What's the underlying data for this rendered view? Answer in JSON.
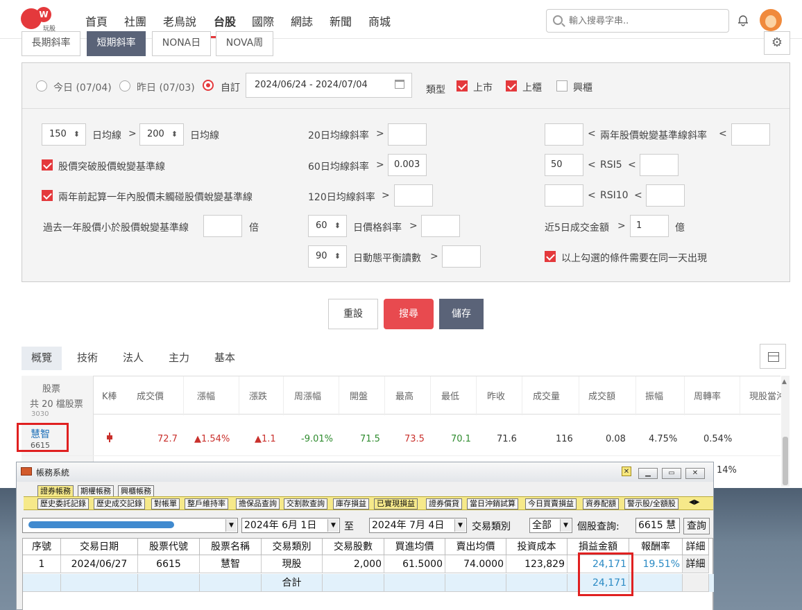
{
  "nav": {
    "logo_text": "玩股網",
    "logo_mark": "W",
    "items": [
      "首頁",
      "社團",
      "老鳥說",
      "台股",
      "國際",
      "網誌",
      "新聞",
      "商城"
    ],
    "active": "台股",
    "search_placeholder": "輸入搜尋字串.."
  },
  "subtabs": [
    "長期斜率",
    "短期斜率",
    "NONA日",
    "NOVA周"
  ],
  "filter": {
    "radio_today": "今日 (07/04)",
    "radio_yesterday": "昨日 (07/03)",
    "radio_custom": "自訂",
    "date_range": "2024/06/24 - 2024/07/04",
    "type_label": "類型",
    "type_listed": "上市",
    "type_otc": "上櫃",
    "type_emerging": "興櫃",
    "ma_a": "150",
    "ma_label_1": "日均線",
    "gt": ">",
    "lt": "<",
    "ma_b": "200",
    "ma_label_2": "日均線",
    "check_break": "股價突破股價蛻變基準線",
    "check_two_year": "兩年前起算一年內股價未觸碰股價蛻變基準線",
    "past_year_label": "過去一年股價小於股價蛻變基準線",
    "times": "倍",
    "slope20": "20日均線斜率",
    "slope60": "60日均線斜率",
    "slope60_val": "0.003",
    "slope120": "120日均線斜率",
    "price_slope_days": "60",
    "price_slope_label": "日價格斜率",
    "balance_days": "90",
    "balance_label": "日動態平衡讀數",
    "two_year_slope": "兩年股價蛻變基準線斜率",
    "rsi5_low": "50",
    "rsi5": "RSI5",
    "rsi10": "RSI10",
    "volume_label": "近5日成交金額",
    "volume_val": "1",
    "volume_unit": "億",
    "same_day": "以上勾選的條件需要在同一天出現"
  },
  "buttons": {
    "reset": "重設",
    "search": "搜尋",
    "save": "儲存"
  },
  "result_tabs": [
    "概覽",
    "技術",
    "法人",
    "主力",
    "基本"
  ],
  "table": {
    "first_col_title": "股票",
    "first_col_sub": "共 20 檔股票",
    "headers": [
      "K棒",
      "成交價",
      "漲幅",
      "漲跌",
      "周漲幅",
      "開盤",
      "最高",
      "最低",
      "昨收",
      "成交量",
      "成交額",
      "振幅",
      "周轉率",
      "現股當沖"
    ],
    "prev_code": "3030",
    "row": {
      "name": "慧智",
      "code": "6615",
      "price": "72.7",
      "change_pct": "▲1.54%",
      "change": "▲1.1",
      "week_pct": "-9.01%",
      "open": "71.5",
      "high": "73.5",
      "low": "70.1",
      "prev_close": "71.6",
      "volume": "116",
      "amount": "0.08",
      "amplitude": "4.75%",
      "turnover": "0.54%"
    },
    "next_partial": "14%"
  },
  "window": {
    "title": "帳務系統",
    "top_tabs": [
      "證券帳務",
      "期權帳務",
      "興櫃帳務"
    ],
    "sub_tabs": [
      "歷史委託記錄",
      "歷史成交記錄",
      "對帳單",
      "整戶維持率",
      "擔保品查詢",
      "交割款查詢",
      "庫存損益",
      "已實現損益",
      "證券償貸",
      "當日沖銷試算",
      "今日買賣損益",
      "資券配額",
      "警示股/全額股"
    ],
    "active_sub_tab": "已實現損益",
    "date_from": "2024年  6月  1日",
    "to_label": "至",
    "date_to": "2024年  7月  4日",
    "trade_type_label": "交易類別",
    "trade_type_value": "全部",
    "stock_query_label": "個股查詢:",
    "stock_query_value": "6615 慧智",
    "query_button": "查詢",
    "headers": [
      "序號",
      "交易日期",
      "股票代號",
      "股票名稱",
      "交易類別",
      "交易股數",
      "買進均價",
      "賣出均價",
      "投資成本",
      "損益金額",
      "報酬率",
      "詳細"
    ],
    "row": {
      "seq": "1",
      "date": "2024/06/27",
      "code": "6615",
      "name": "慧智",
      "type": "現股",
      "shares": "2,000",
      "buy_avg": "61.5000",
      "sell_avg": "74.0000",
      "cost": "123,829",
      "pnl": "24,171",
      "return": "19.51%",
      "detail": "詳細"
    },
    "total_label": "合計",
    "total_pnl": "24,171"
  }
}
